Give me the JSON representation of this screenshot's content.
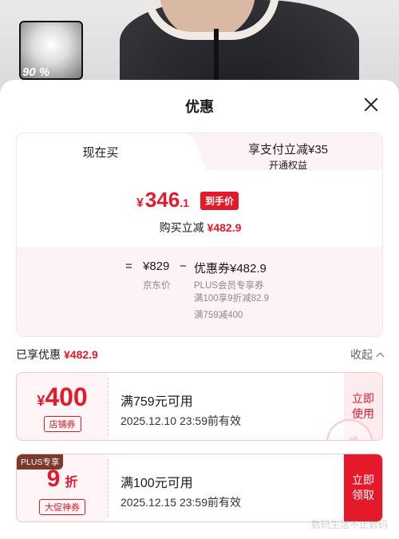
{
  "product": {
    "thumbnail_badge": "90 %"
  },
  "sheet": {
    "title": "优惠"
  },
  "tabs": {
    "active": "现在买",
    "other_line1": "享支付立减¥35",
    "other_line2": "开通权益"
  },
  "price": {
    "yen": "¥",
    "int": "346",
    "dec": ".1",
    "badge": "到手价",
    "reduce_label": "购买立减",
    "reduce_amount": "¥482.9"
  },
  "calc": {
    "eq": "=",
    "base": "¥829",
    "minus": "−",
    "coupon": "优惠券¥482.9",
    "base_label": "京东价",
    "coupon_notes": [
      "PLUS会员专享券",
      "满100享9折减82.9",
      "满759减400"
    ]
  },
  "enjoyed": {
    "label": "已享优惠",
    "amount": "¥482.9",
    "collapse": "收起"
  },
  "coupons": [
    {
      "yen": "¥",
      "value": "400",
      "unit": "",
      "tag": "店铺券",
      "plus": "",
      "condition": "满759元可用",
      "expiry": "2025.12.10 23:59前有效",
      "action": "立即使用",
      "stamp": "已领"
    },
    {
      "yen": "",
      "value": "9",
      "unit": "折",
      "tag": "大促神券",
      "plus": "PLUS专享",
      "condition": "满100元可用",
      "expiry": "2025.12.15 23:59前有效",
      "action": "立即领取",
      "stamp": ""
    }
  ],
  "watermark": "数码生活不止数码"
}
